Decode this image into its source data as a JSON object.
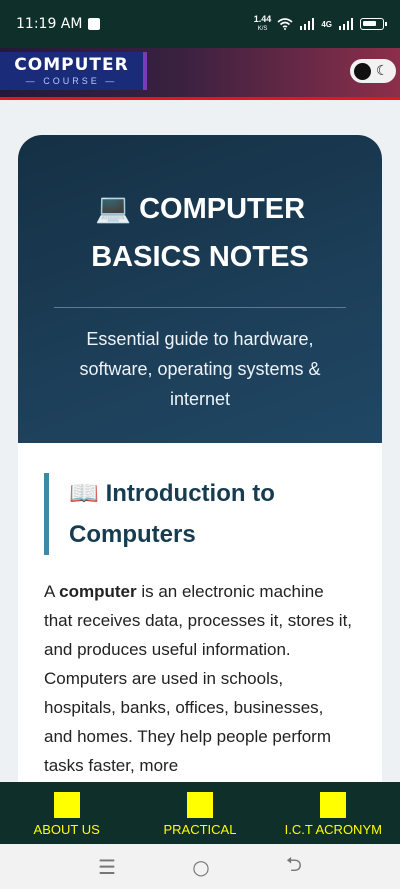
{
  "status": {
    "time": "11:19 AM",
    "speed": "1.44",
    "speed_unit": "K/S",
    "net": "4G"
  },
  "header": {
    "logo_main": "COMPUTER",
    "logo_sub": "COURSE",
    "theme_icon": "moon-icon"
  },
  "hero": {
    "icon": "💻",
    "title": "COMPUTER BASICS NOTES",
    "subtitle": "Essential guide to hardware, software, operating systems & internet"
  },
  "section": {
    "icon": "📖",
    "heading": "Introduction to Computers",
    "body_prefix": "A ",
    "body_bold": "computer",
    "body_text": " is an electronic machine that receives data, processes it, stores it, and produces useful information. Computers are used in schools, hospitals, banks, offices, businesses, and homes. They help people perform tasks faster, more"
  },
  "bottom_nav": {
    "items": [
      {
        "label": "ABOUT US"
      },
      {
        "label": "PRACTICAL"
      },
      {
        "label": "I.C.T ACRONYM"
      }
    ],
    "accent": "#ffff00",
    "background": "#0f2f2a"
  },
  "system_nav": {
    "menu": "☰",
    "home": "○",
    "back": "⮌"
  }
}
